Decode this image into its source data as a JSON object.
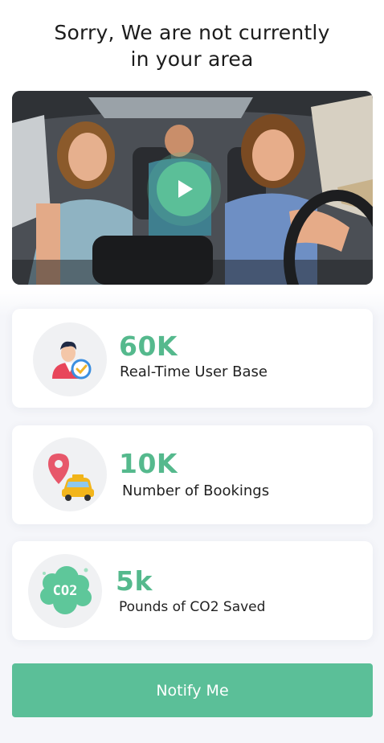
{
  "header": {
    "title_line1": "Sorry, We are not currently",
    "title_line2": "in your area"
  },
  "video": {
    "thumbnail": "friends-in-car-photo",
    "play_icon": "play-icon"
  },
  "stats": [
    {
      "value": "60K",
      "label": "Real-Time User Base",
      "icon": "user-verified-icon"
    },
    {
      "value": "10K",
      "label": "Number of Bookings",
      "icon": "taxi-location-icon"
    },
    {
      "value": "5k",
      "label": "Pounds of CO2 Saved",
      "icon": "co2-cloud-icon",
      "icon_text": "CO2"
    }
  ],
  "notify_button": {
    "label": "Notify Me"
  },
  "colors": {
    "accent": "#5bbf98",
    "stat_value": "#55b98d",
    "icon_circle": "#f0f1f3",
    "background": "#f5f6fa"
  }
}
